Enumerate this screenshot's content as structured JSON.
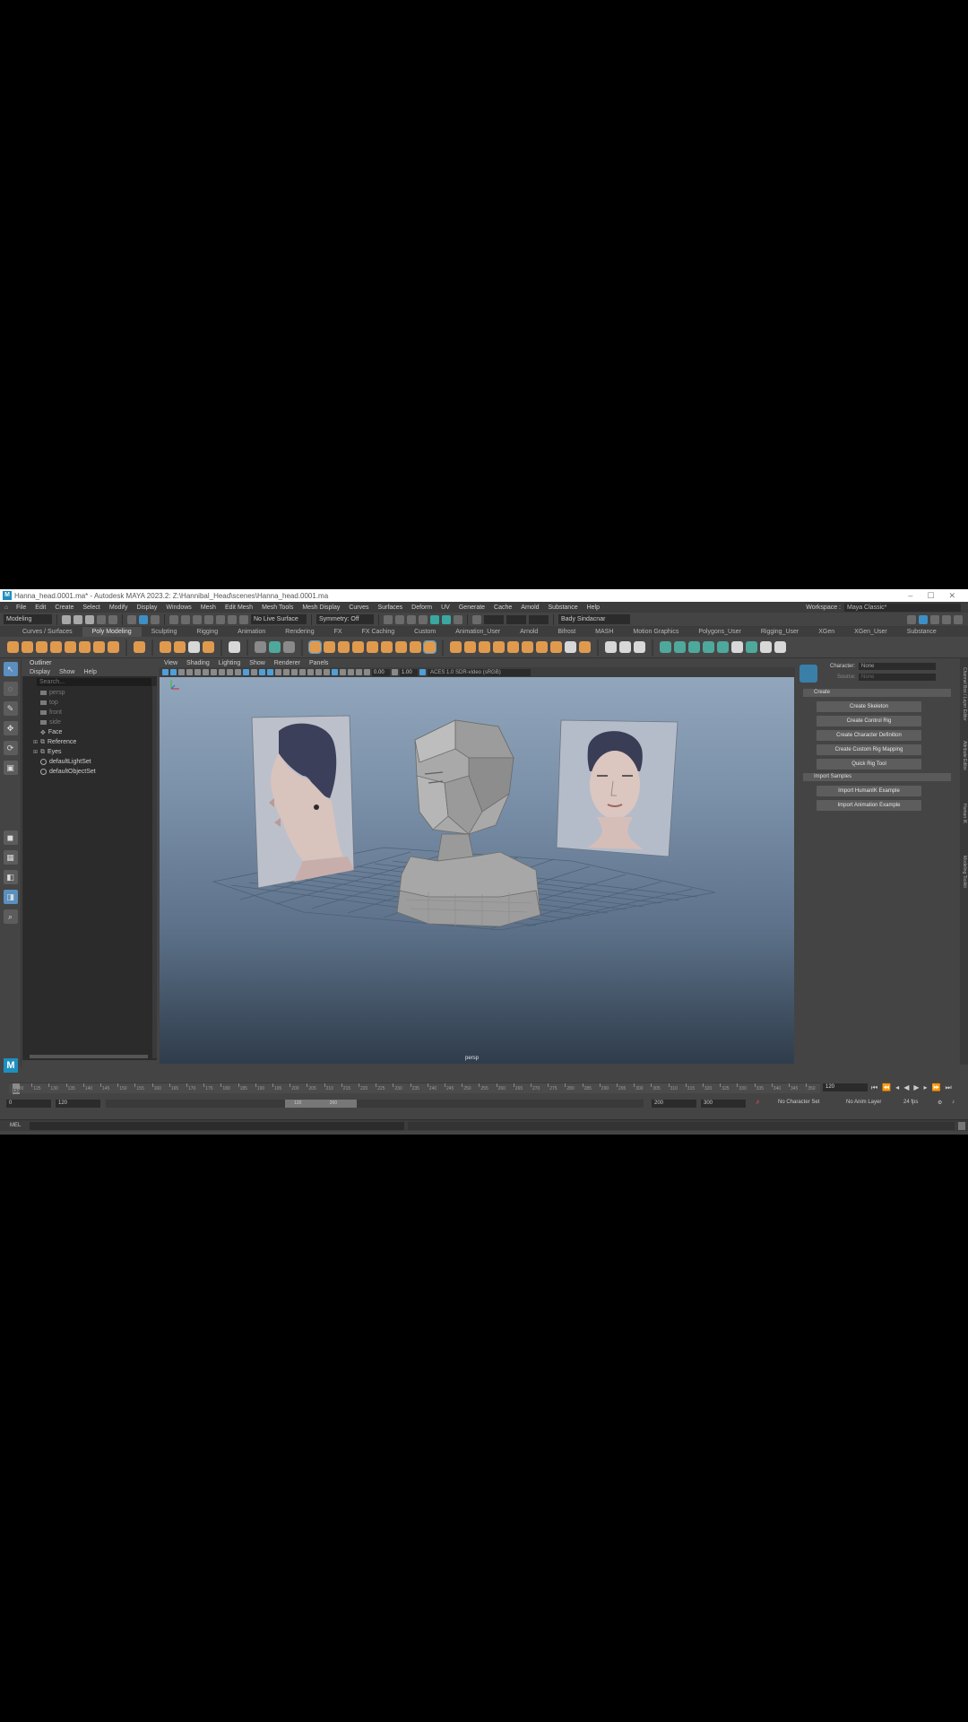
{
  "title_bar": {
    "title": "Hanna_head.0001.ma* - Autodesk MAYA 2023.2: Z:\\Hannibal_Head\\scenes\\Hanna_head.0001.ma"
  },
  "menu": [
    "File",
    "Edit",
    "Create",
    "Select",
    "Modify",
    "Display",
    "Windows",
    "Mesh",
    "Edit Mesh",
    "Mesh Tools",
    "Mesh Display",
    "Curves",
    "Surfaces",
    "Deform",
    "UV",
    "Generate",
    "Cache",
    "Arnold",
    "Substance",
    "Help"
  ],
  "workspace": {
    "label": "Workspace :",
    "value": "Maya Classic*"
  },
  "status_line": {
    "mode": "Modeling",
    "live_surface": "No Live Surface",
    "symmetry": "Symmetry: Off",
    "user": "Bady Sindacnar"
  },
  "shelf_tabs": [
    "Curves / Surfaces",
    "Poly Modeling",
    "Sculpting",
    "Rigging",
    "Animation",
    "Rendering",
    "FX",
    "FX Caching",
    "Custom",
    "Animation_User",
    "Arnold",
    "Bifrost",
    "MASH",
    "Motion Graphics",
    "Polygons_User",
    "Rigging_User",
    "XGen",
    "XGen_User",
    "Substance"
  ],
  "active_shelf_tab": "Poly Modeling",
  "outliner": {
    "title": "Outliner",
    "menu": [
      "Display",
      "Show",
      "Help"
    ],
    "search_placeholder": "Search...",
    "items": [
      {
        "label": "persp",
        "dim": true
      },
      {
        "label": "top",
        "dim": true
      },
      {
        "label": "front",
        "dim": true
      },
      {
        "label": "side",
        "dim": true
      },
      {
        "label": "Face",
        "dim": false
      },
      {
        "label": "Reference",
        "dim": false
      },
      {
        "label": "Eyes",
        "dim": false
      },
      {
        "label": "defaultLightSet",
        "dim": false
      },
      {
        "label": "defaultObjectSet",
        "dim": false
      }
    ]
  },
  "viewport": {
    "menu": [
      "View",
      "Shading",
      "Lighting",
      "Show",
      "Renderer",
      "Panels"
    ],
    "exposure": "0.00",
    "gamma": "1.00",
    "color_space": "ACES 1.0 SDR-video (sRGB)",
    "camera_label": "persp"
  },
  "hik": {
    "character_label": "Character:",
    "character_value": "None",
    "source_label": "Source:",
    "source_value": "None",
    "create_section": "Create",
    "create_buttons": [
      "Create Skeleton",
      "Create Control Rig",
      "Create Character Definition",
      "Create Custom Rig Mapping",
      "Quick Rig Tool"
    ],
    "import_section": "Import Samples",
    "import_buttons": [
      "Import HumanIK Example",
      "Import Animation Example"
    ]
  },
  "side_tabs": [
    "Channel Box / Layer Editor",
    "Attribute Editor",
    "Modeling Toolkit",
    "Human IK"
  ],
  "time_slider": {
    "current_frame": "120",
    "frame_field": "120",
    "ticks": [
      "120",
      "125",
      "130",
      "135",
      "140",
      "145",
      "150",
      "155",
      "160",
      "165",
      "170",
      "175",
      "180",
      "185",
      "190",
      "195",
      "200",
      "205",
      "210",
      "215",
      "220",
      "225",
      "230",
      "235",
      "240",
      "245",
      "250",
      "255",
      "260",
      "265",
      "270",
      "275",
      "280",
      "285",
      "290",
      "295",
      "300",
      "305",
      "310",
      "315",
      "320",
      "325",
      "330",
      "335",
      "340",
      "345",
      "350"
    ]
  },
  "range_slider": {
    "start": "0",
    "anim_start": "120",
    "thumb_start": "120",
    "thumb_end": "200",
    "anim_end": "200",
    "end": "300",
    "character_set": "No Character Set",
    "anim_layer": "No Anim Layer",
    "fps": "24 fps"
  },
  "command_line": {
    "label": "MEL"
  }
}
